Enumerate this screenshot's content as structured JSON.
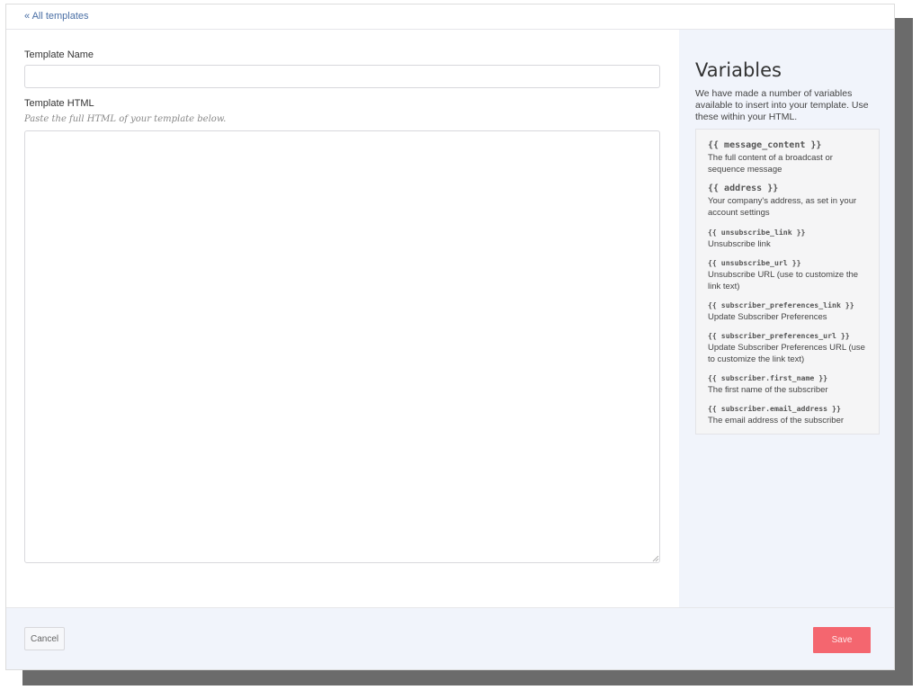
{
  "nav": {
    "back_link": "« All templates"
  },
  "form": {
    "name_label": "Template Name",
    "name_value": "",
    "html_label": "Template HTML",
    "html_hint": "Paste the full HTML of your template below.",
    "html_value": ""
  },
  "variables": {
    "title": "Variables",
    "description": "We have made a number of variables available to insert into your template. Use these within your HTML.",
    "items": [
      {
        "code": "{{ message_content }}",
        "desc": "The full content of a broadcast or sequence message"
      },
      {
        "code": "{{ address }}",
        "desc": "Your company's address, as set in your account settings"
      },
      {
        "code": "{{ unsubscribe_link }}",
        "desc": "Unsubscribe link"
      },
      {
        "code": "{{ unsubscribe_url }}",
        "desc": "Unsubscribe URL (use to customize the link text)"
      },
      {
        "code": "{{ subscriber_preferences_link }}",
        "desc": "Update Subscriber Preferences"
      },
      {
        "code": "{{ subscriber_preferences_url }}",
        "desc": "Update Subscriber Preferences URL (use to customize the link text)"
      },
      {
        "code": "{{ subscriber.first_name }}",
        "desc": "The first name of the subscriber"
      },
      {
        "code": "{{ subscriber.email_address }}",
        "desc": "The email address of the subscriber"
      }
    ]
  },
  "footer": {
    "cancel_label": "Cancel",
    "save_label": "Save"
  },
  "colors": {
    "save_button": "#f4666f",
    "sidebar_bg": "#f1f4fb",
    "link": "#4a6fa5"
  }
}
